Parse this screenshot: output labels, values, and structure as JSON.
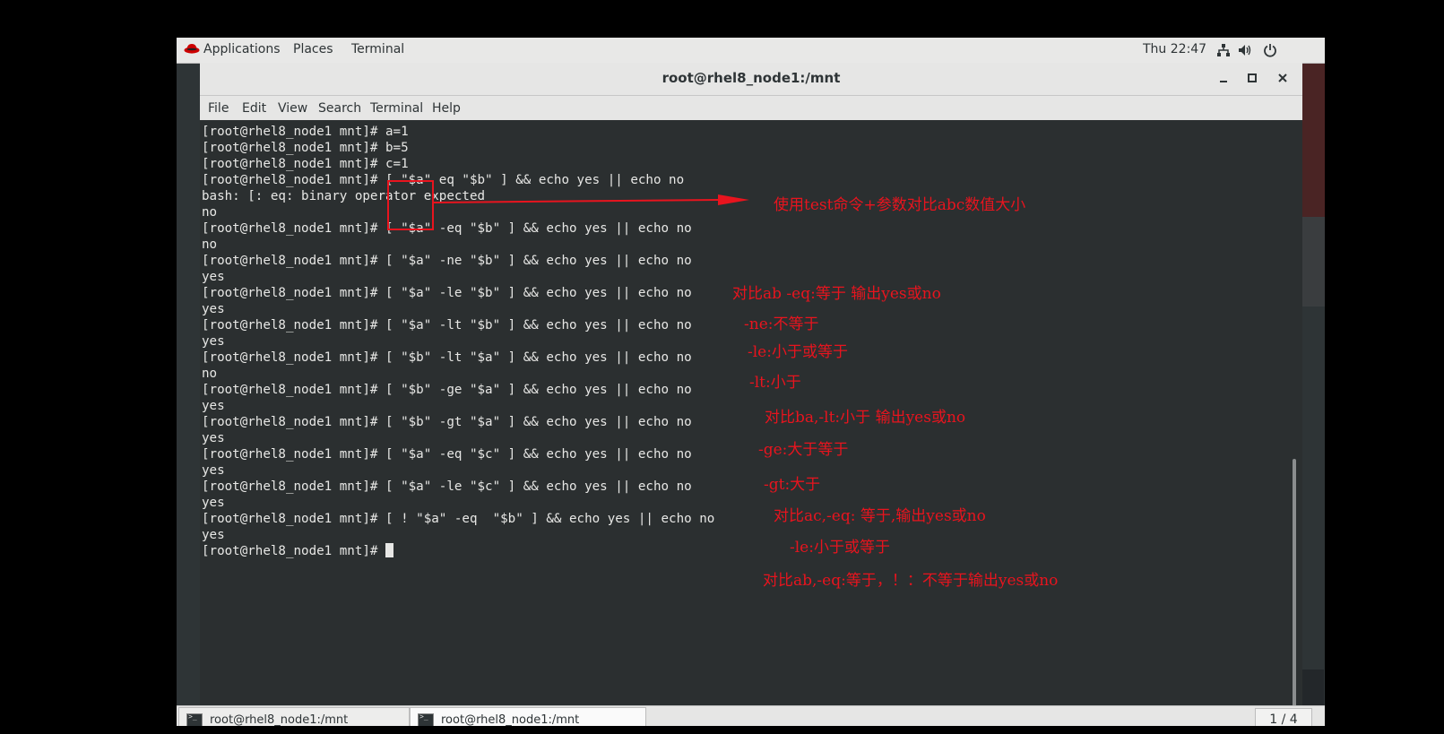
{
  "topbar": {
    "applications_label": "Applications",
    "places_label": "Places",
    "terminal_label": "Terminal",
    "clock": "Thu 22:47"
  },
  "window": {
    "title": "root@rhel8_node1:/mnt",
    "menu": [
      "File",
      "Edit",
      "View",
      "Search",
      "Terminal",
      "Help"
    ]
  },
  "terminal": {
    "lines": [
      "[root@rhel8_node1 mnt]# a=1",
      "[root@rhel8_node1 mnt]# b=5",
      "[root@rhel8_node1 mnt]# c=1",
      "[root@rhel8_node1 mnt]# [ \"$a\" eq \"$b\" ] && echo yes || echo no",
      "bash: [: eq: binary operator expected",
      "no",
      "[root@rhel8_node1 mnt]# [ \"$a\" -eq \"$b\" ] && echo yes || echo no",
      "no",
      "[root@rhel8_node1 mnt]# [ \"$a\" -ne \"$b\" ] && echo yes || echo no",
      "yes",
      "[root@rhel8_node1 mnt]# [ \"$a\" -le \"$b\" ] && echo yes || echo no",
      "yes",
      "[root@rhel8_node1 mnt]# [ \"$a\" -lt \"$b\" ] && echo yes || echo no",
      "yes",
      "[root@rhel8_node1 mnt]# [ \"$b\" -lt \"$a\" ] && echo yes || echo no",
      "no",
      "[root@rhel8_node1 mnt]# [ \"$b\" -ge \"$a\" ] && echo yes || echo no",
      "yes",
      "[root@rhel8_node1 mnt]# [ \"$b\" -gt \"$a\" ] && echo yes || echo no",
      "yes",
      "[root@rhel8_node1 mnt]# [ \"$a\" -eq \"$c\" ] && echo yes || echo no",
      "yes",
      "[root@rhel8_node1 mnt]# [ \"$a\" -le \"$c\" ] && echo yes || echo no",
      "yes",
      "[root@rhel8_node1 mnt]# [ ! \"$a\" -eq  \"$b\" ] && echo yes || echo no",
      "yes"
    ],
    "prompt": "[root@rhel8_node1 mnt]# "
  },
  "annotations": [
    "使用test命令+参数对比abc数值大小",
    "对比ab -eq:等于 输出yes或no",
    "-ne:不等于",
    "-le:小于或等于",
    "-lt:小于",
    "对比ba,-lt:小于 输出yes或no",
    "-ge:大于等于",
    "-gt:大于",
    "对比ac,-eq: 等于,输出yes或no",
    "-le:小于或等于",
    "对比ab,-eq:等于，！：不等于输出yes或no"
  ],
  "taskbar": {
    "tasks": [
      "root@rhel8_node1:/mnt",
      "root@rhel8_node1:/mnt"
    ],
    "pager": "1 / 4"
  },
  "colors": {
    "annotation": "#e8141e",
    "terminal_bg": "#2b2f30",
    "terminal_fg": "#e7e7e5"
  }
}
